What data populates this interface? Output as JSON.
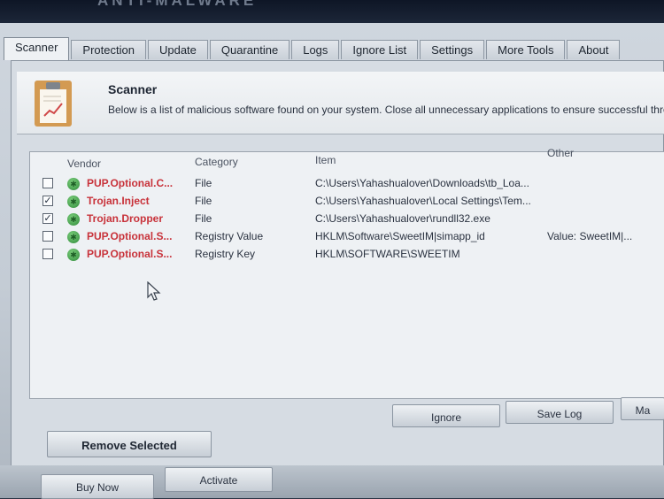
{
  "app": {
    "title": "ANTI-MALWARE"
  },
  "tabs": [
    {
      "label": "Scanner",
      "active": true
    },
    {
      "label": "Protection"
    },
    {
      "label": "Update"
    },
    {
      "label": "Quarantine"
    },
    {
      "label": "Logs"
    },
    {
      "label": "Ignore List"
    },
    {
      "label": "Settings"
    },
    {
      "label": "More Tools"
    },
    {
      "label": "About"
    }
  ],
  "header": {
    "title": "Scanner",
    "description": "Below is a list of malicious software found on your system. Close all unnecessary applications to ensure successful threa",
    "icon": "clipboard-icon"
  },
  "table": {
    "columns": {
      "vendor": "Vendor",
      "category": "Category",
      "item": "Item",
      "other": "Other"
    },
    "rows": [
      {
        "checked": false,
        "vendor": "PUP.Optional.C...",
        "category": "File",
        "item": "C:\\Users\\Yahashualover\\Downloads\\tb_Loa...",
        "other": ""
      },
      {
        "checked": true,
        "vendor": "Trojan.Inject",
        "category": "File",
        "item": "C:\\Users\\Yahashualover\\Local Settings\\Tem...",
        "other": ""
      },
      {
        "checked": true,
        "vendor": "Trojan.Dropper",
        "category": "File",
        "item": "C:\\Users\\Yahashualover\\rundll32.exe",
        "other": ""
      },
      {
        "checked": false,
        "vendor": "PUP.Optional.S...",
        "category": "Registry Value",
        "item": "HKLM\\Software\\SweetIM|simapp_id",
        "other": "Value: SweetIM|..."
      },
      {
        "checked": false,
        "vendor": "PUP.Optional.S...",
        "category": "Registry Key",
        "item": "HKLM\\SOFTWARE\\SWEETIM",
        "other": ""
      }
    ]
  },
  "buttons": {
    "ignore": "Ignore",
    "save_log": "Save Log",
    "more": "Ma",
    "remove_selected": "Remove Selected",
    "buy_now": "Buy Now",
    "activate": "Activate"
  },
  "colors": {
    "threat_text": "#c8323a",
    "window_bg": "#c4ccd5"
  }
}
